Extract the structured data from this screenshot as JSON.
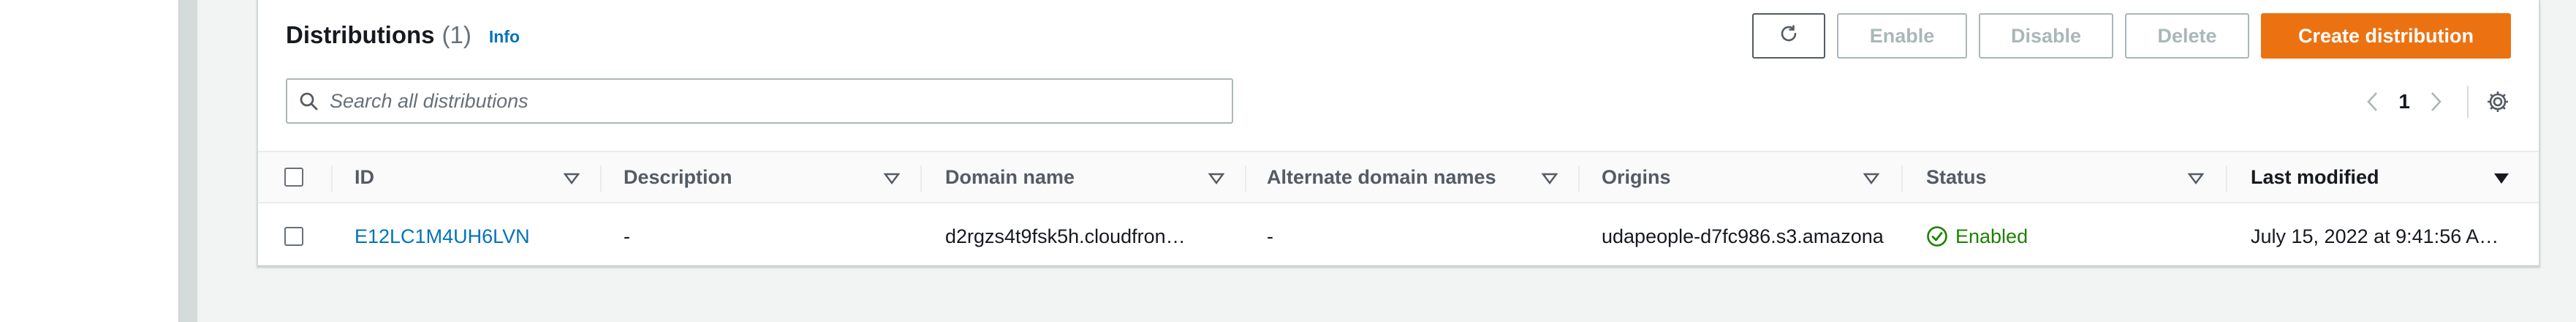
{
  "header": {
    "title": "Distributions",
    "count": "(1)",
    "info_label": "Info"
  },
  "actions": {
    "refresh_icon": "refresh-icon",
    "enable_label": "Enable",
    "disable_label": "Disable",
    "delete_label": "Delete",
    "create_label": "Create distribution"
  },
  "search": {
    "placeholder": "Search all distributions"
  },
  "pagination": {
    "current_page": "1"
  },
  "table": {
    "columns": [
      {
        "label": "ID",
        "sortable": true,
        "sorted": false
      },
      {
        "label": "Description",
        "sortable": true,
        "sorted": false
      },
      {
        "label": "Domain name",
        "sortable": true,
        "sorted": false
      },
      {
        "label": "Alternate domain names",
        "sortable": true,
        "sorted": false
      },
      {
        "label": "Origins",
        "sortable": true,
        "sorted": false
      },
      {
        "label": "Status",
        "sortable": true,
        "sorted": false
      },
      {
        "label": "Last modified",
        "sortable": true,
        "sorted": true
      }
    ],
    "rows": [
      {
        "id": "E12LC1M4UH6LVN",
        "description": "-",
        "domain_name": "d2rgzs4t9fsk5h.cloudfron…",
        "alternate_domain_names": "-",
        "origins": "udapeople-d7fc986.s3.amazona",
        "status": "Enabled",
        "last_modified": "July 15, 2022 at 9:41:56 A…"
      }
    ]
  },
  "colors": {
    "primary": "#ec7211",
    "link": "#0073bb",
    "success": "#1d8102"
  }
}
